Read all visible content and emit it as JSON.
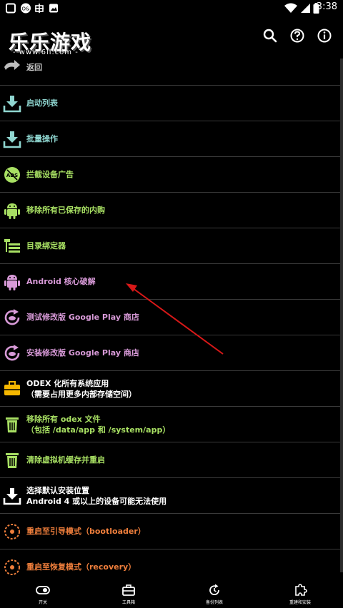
{
  "statusbar": {
    "time": "3:38"
  },
  "appbar": {
    "logo_title": "乐乐游戏",
    "logo_sub": "- www.6ll.com -"
  },
  "menu": [
    {
      "label": "返回",
      "color": "#c8c8c8"
    },
    {
      "label": "启动列表",
      "color": "#8fd6d0"
    },
    {
      "label": "批量操作",
      "color": "#8fd6d0"
    },
    {
      "label": "拦截设备广告",
      "color": "#a8e063"
    },
    {
      "label": "移除所有已保存的内购",
      "color": "#a8e063"
    },
    {
      "label": "目录绑定器",
      "color": "#a8e063"
    },
    {
      "label": "Android 核心破解",
      "color": "#d89ad8"
    },
    {
      "label": "测试修改版 Google Play 商店",
      "color": "#d89ad8"
    },
    {
      "label": "安装修改版 Google Play 商店",
      "color": "#d89ad8"
    },
    {
      "label": "ODEX 化所有系统应用\n（需要占用更多内部存储空间）",
      "color": "#ffffff"
    },
    {
      "label": "移除所有 odex 文件\n（包括 /data/app 和 /system/app）",
      "color": "#a8e063"
    },
    {
      "label": "清除虚拟机缓存并重启",
      "color": "#a8e063"
    },
    {
      "label": "选择默认安装位置\nAndroid 4 或以上的设备可能无法使用",
      "color": "#ffffff"
    },
    {
      "label": "重启至引导模式（bootloader）",
      "color": "#f07f3c"
    },
    {
      "label": "重启至恢复模式（recovery）",
      "color": "#f07f3c"
    }
  ],
  "bottomnav": [
    {
      "label": "开关",
      "icon": "toggle-icon"
    },
    {
      "label": "工具箱",
      "icon": "toolbox-icon"
    },
    {
      "label": "备份列表",
      "icon": "backup-icon"
    },
    {
      "label": "重建和安装",
      "icon": "puzzle-icon"
    }
  ]
}
